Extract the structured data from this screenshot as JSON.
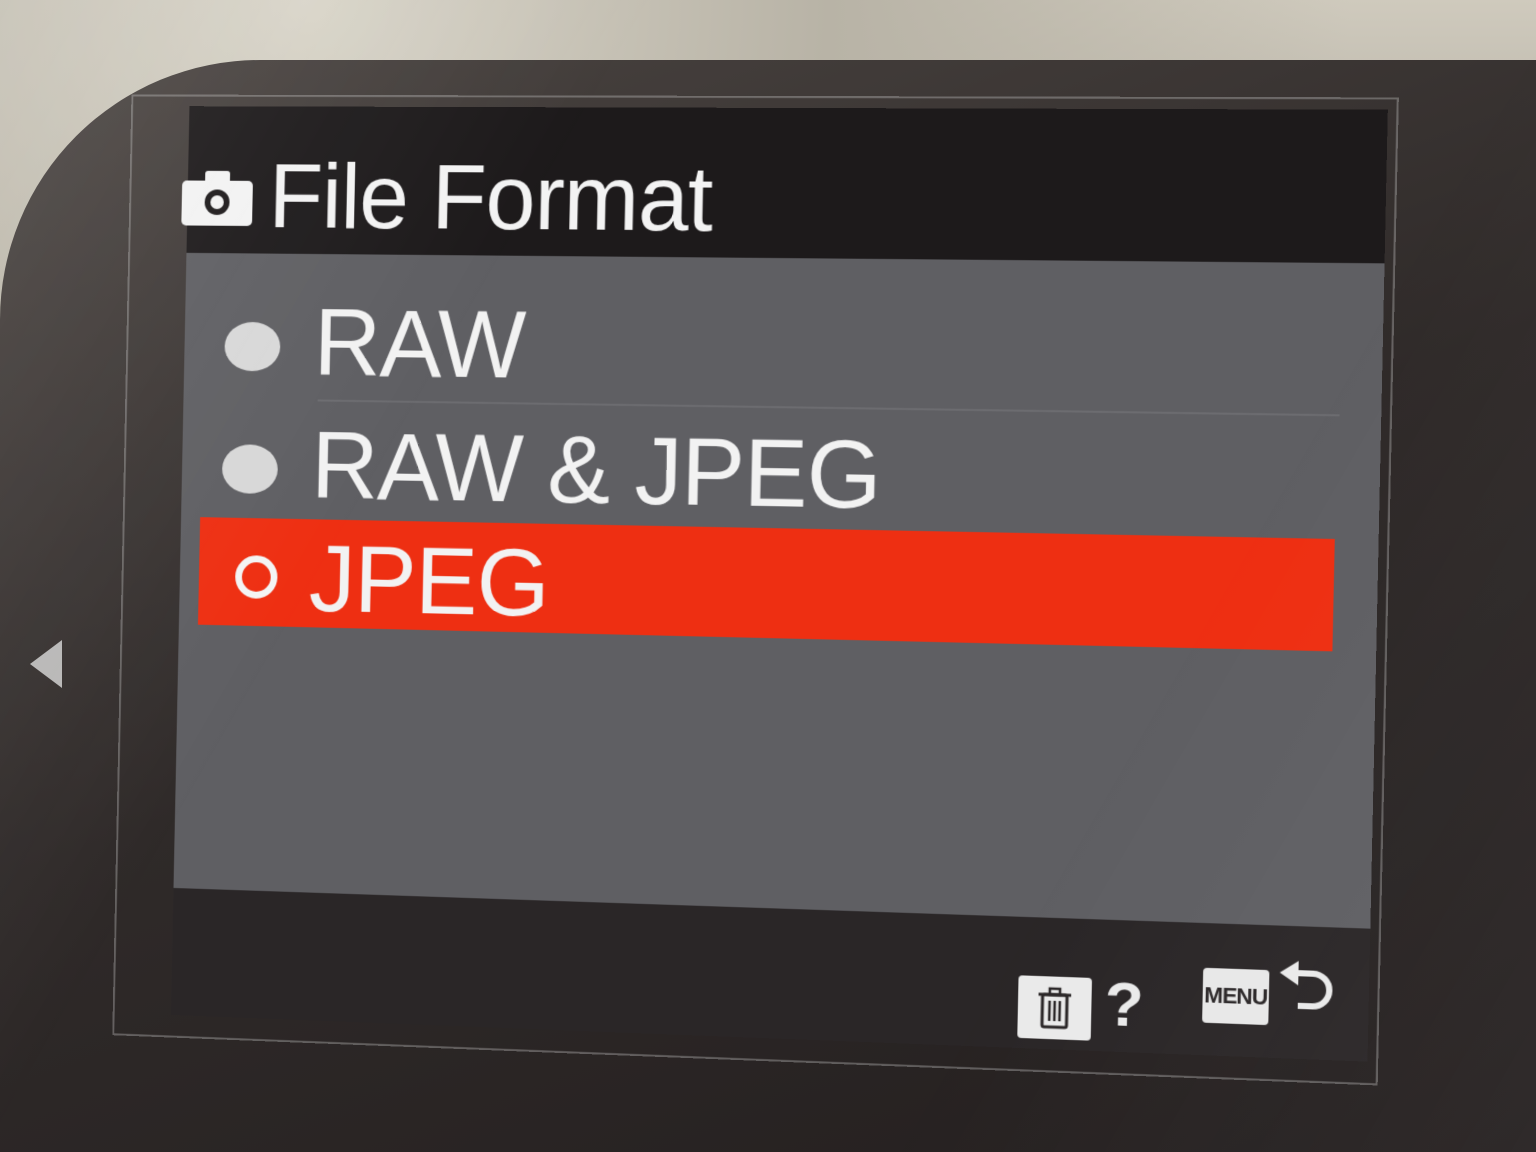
{
  "menu": {
    "title": "File Format",
    "title_icon": "camera-icon",
    "options": [
      {
        "label": "RAW",
        "selected": false
      },
      {
        "label": "RAW & JPEG",
        "selected": false
      },
      {
        "label": "JPEG",
        "selected": true
      }
    ]
  },
  "footer": {
    "delete_icon": "trash-icon",
    "help_label": "?",
    "menu_label": "MENU",
    "back_icon": "return-arrow-icon"
  },
  "colors": {
    "header_bg": "#1d1a1b",
    "list_bg": "#5f5f63",
    "selection": "#ee2f12",
    "text": "#f2f2f2"
  }
}
